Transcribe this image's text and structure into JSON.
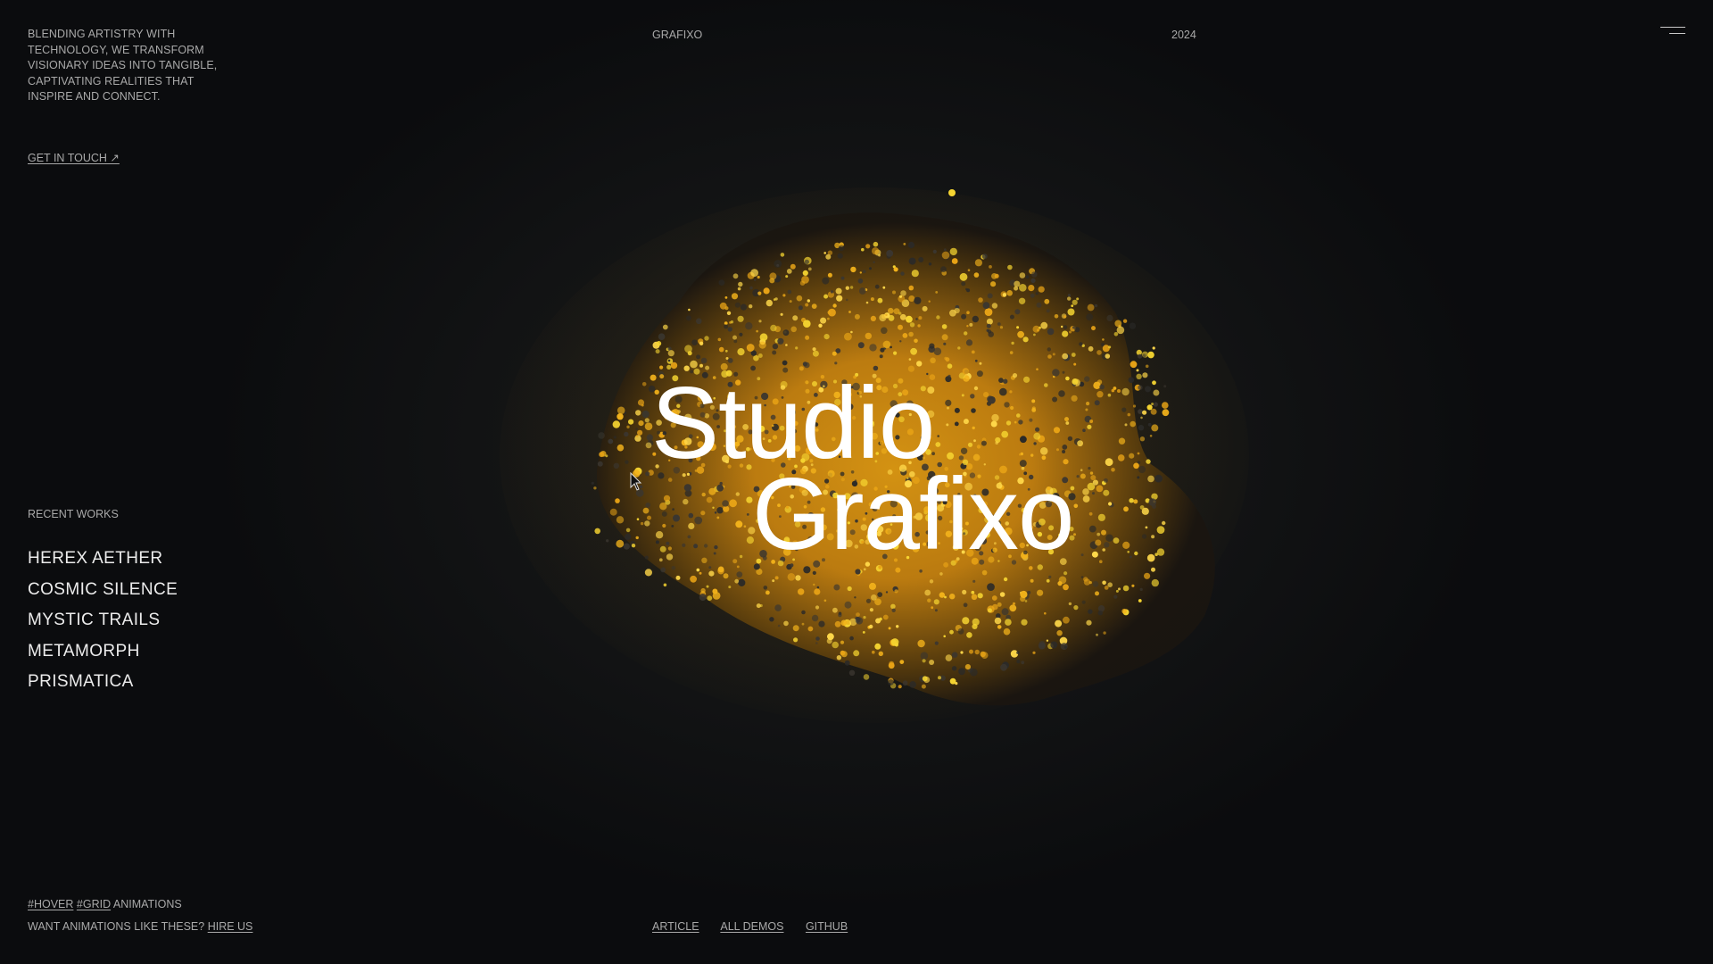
{
  "intro": {
    "text": "BLENDING ARTISTRY WITH TECHNOLOGY, WE TRANSFORM VISIONARY IDEAS INTO TANGIBLE, CAPTIVATING REALITIES THAT INSPIRE AND CONNECT.",
    "cta_label": "GET IN TOUCH ↗"
  },
  "header": {
    "brand": "GRAFIXO",
    "year": "2024",
    "menu_icon": "hamburger-icon"
  },
  "hero": {
    "line1": "Studio",
    "line2": "Grafixo"
  },
  "recent": {
    "label": "RECENT WORKS",
    "items": [
      "HEREX AETHER",
      "COSMIC SILENCE",
      "MYSTIC TRAILS",
      "METAMORPH",
      "PRISMATICA"
    ]
  },
  "footer": {
    "tag1": "#HOVER",
    "tag2": "#GRID",
    "tags_suffix": "ANIMATIONS",
    "hire_prompt": "WANT ANIMATIONS LIKE THESE?",
    "hire_link": "HIRE US",
    "links": [
      "ARTICLE",
      "ALL DEMOS",
      "GITHUB"
    ]
  },
  "colors": {
    "background": "#0e0f11",
    "accent_gold": "#f2b21b",
    "accent_yellow": "#f6d531",
    "dark_particle": "#2b2a28",
    "text_primary": "#ffffff",
    "text_muted": "#a9a9a9"
  }
}
